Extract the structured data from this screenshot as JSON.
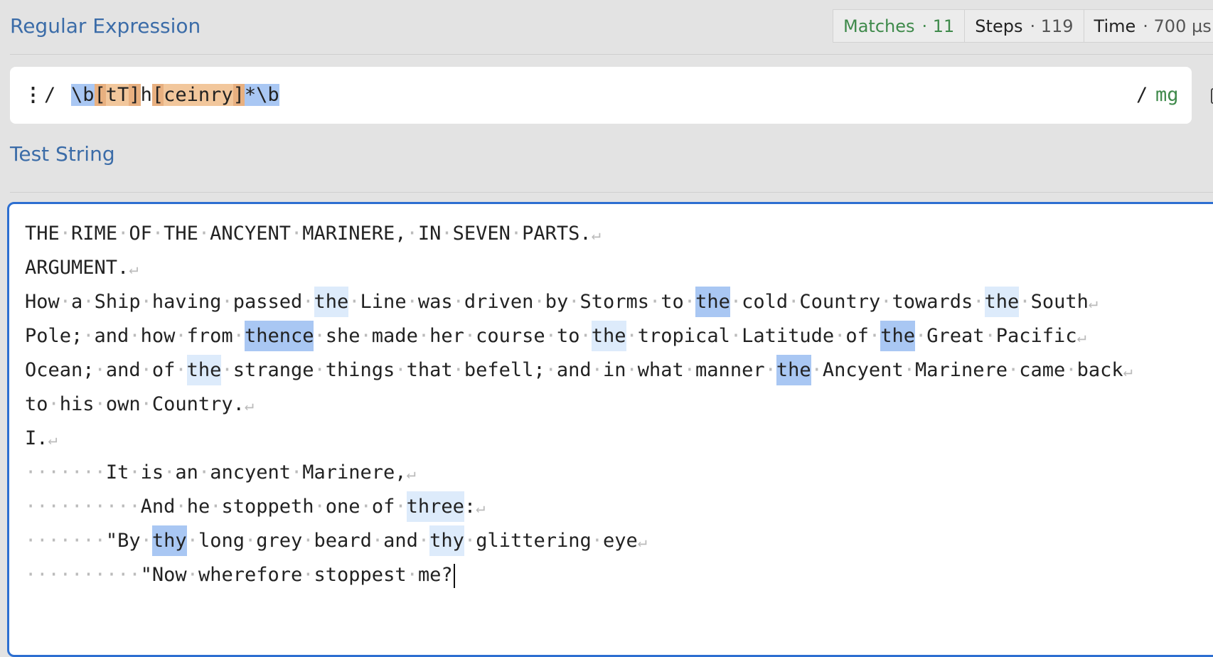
{
  "header": {
    "title": "Regular Expression"
  },
  "stats": [
    {
      "label": "Matches",
      "value": "· 11"
    },
    {
      "label": "Steps",
      "value": "· 119"
    },
    {
      "label": "Time",
      "value": "· 700 µs"
    }
  ],
  "regex": {
    "menu_icon": "vertical-dots-icon",
    "open_delimiter": "/",
    "pattern": "\\b[tT]h[ceinry]*\\b",
    "close_delimiter": "/",
    "flags": "mg",
    "copy_icon": "copy-icon"
  },
  "test_string": {
    "title": "Test String",
    "lines": [
      "THE RIME OF THE ANCYENT MARINERE, IN SEVEN PARTS.",
      "ARGUMENT.",
      "How a Ship having passed the Line was driven by Storms to the cold Country towards the South",
      "Pole; and how from thence she made her course to the tropical Latitude of the Great Pacific",
      "Ocean; and of the strange things that befell; and in what manner the Ancyent Marinere came back",
      "to his own Country.",
      "I.",
      "       It is an ancyent Marinere,",
      "          And he stoppeth one of three:",
      "       \"By thy long grey beard and thy glittering eye",
      "          \"Now wherefore stoppest me?"
    ]
  },
  "colors": {
    "accent": "#3b6ca8",
    "flags_green": "#3f8a4b",
    "match_light": "#ddebfb",
    "match_dark": "#a9c7f3",
    "focus_border": "#2d6fd1"
  }
}
